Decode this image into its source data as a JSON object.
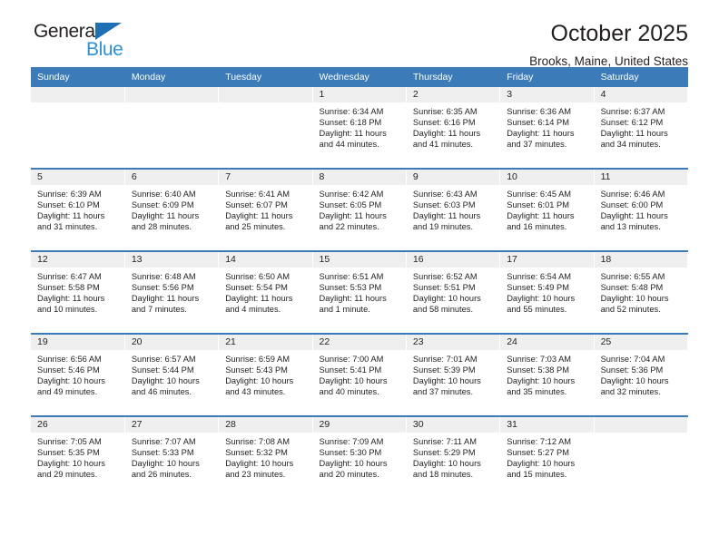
{
  "brand": {
    "name_top": "General",
    "name_bottom": "Blue",
    "triangle_color": "#1f6fb5",
    "blue_color": "#2f90d8",
    "dark_color": "#231f20"
  },
  "header": {
    "title": "October 2025",
    "subtitle": "Brooks, Maine, United States"
  },
  "theme": {
    "header_bg": "#3b7cb8",
    "header_text": "#ffffff",
    "daynum_bg": "#efefef",
    "cell_bg": "#ffffff",
    "text": "#231f20"
  },
  "weekday_headers": [
    "Sunday",
    "Monday",
    "Tuesday",
    "Wednesday",
    "Thursday",
    "Friday",
    "Saturday"
  ],
  "labels": {
    "sunrise": "Sunrise:",
    "sunset": "Sunset:",
    "daylight": "Daylight:"
  },
  "weeks": [
    [
      {
        "day": "",
        "empty": true,
        "line1": "",
        "line2": "",
        "line3": "",
        "line4": ""
      },
      {
        "day": "",
        "empty": true,
        "line1": "",
        "line2": "",
        "line3": "",
        "line4": ""
      },
      {
        "day": "",
        "empty": true,
        "line1": "",
        "line2": "",
        "line3": "",
        "line4": ""
      },
      {
        "day": "1",
        "empty": false,
        "line1": "Sunrise: 6:34 AM",
        "line2": "Sunset: 6:18 PM",
        "line3": "Daylight: 11 hours",
        "line4": "and 44 minutes."
      },
      {
        "day": "2",
        "empty": false,
        "line1": "Sunrise: 6:35 AM",
        "line2": "Sunset: 6:16 PM",
        "line3": "Daylight: 11 hours",
        "line4": "and 41 minutes."
      },
      {
        "day": "3",
        "empty": false,
        "line1": "Sunrise: 6:36 AM",
        "line2": "Sunset: 6:14 PM",
        "line3": "Daylight: 11 hours",
        "line4": "and 37 minutes."
      },
      {
        "day": "4",
        "empty": false,
        "line1": "Sunrise: 6:37 AM",
        "line2": "Sunset: 6:12 PM",
        "line3": "Daylight: 11 hours",
        "line4": "and 34 minutes."
      }
    ],
    [
      {
        "day": "5",
        "empty": false,
        "line1": "Sunrise: 6:39 AM",
        "line2": "Sunset: 6:10 PM",
        "line3": "Daylight: 11 hours",
        "line4": "and 31 minutes."
      },
      {
        "day": "6",
        "empty": false,
        "line1": "Sunrise: 6:40 AM",
        "line2": "Sunset: 6:09 PM",
        "line3": "Daylight: 11 hours",
        "line4": "and 28 minutes."
      },
      {
        "day": "7",
        "empty": false,
        "line1": "Sunrise: 6:41 AM",
        "line2": "Sunset: 6:07 PM",
        "line3": "Daylight: 11 hours",
        "line4": "and 25 minutes."
      },
      {
        "day": "8",
        "empty": false,
        "line1": "Sunrise: 6:42 AM",
        "line2": "Sunset: 6:05 PM",
        "line3": "Daylight: 11 hours",
        "line4": "and 22 minutes."
      },
      {
        "day": "9",
        "empty": false,
        "line1": "Sunrise: 6:43 AM",
        "line2": "Sunset: 6:03 PM",
        "line3": "Daylight: 11 hours",
        "line4": "and 19 minutes."
      },
      {
        "day": "10",
        "empty": false,
        "line1": "Sunrise: 6:45 AM",
        "line2": "Sunset: 6:01 PM",
        "line3": "Daylight: 11 hours",
        "line4": "and 16 minutes."
      },
      {
        "day": "11",
        "empty": false,
        "line1": "Sunrise: 6:46 AM",
        "line2": "Sunset: 6:00 PM",
        "line3": "Daylight: 11 hours",
        "line4": "and 13 minutes."
      }
    ],
    [
      {
        "day": "12",
        "empty": false,
        "line1": "Sunrise: 6:47 AM",
        "line2": "Sunset: 5:58 PM",
        "line3": "Daylight: 11 hours",
        "line4": "and 10 minutes."
      },
      {
        "day": "13",
        "empty": false,
        "line1": "Sunrise: 6:48 AM",
        "line2": "Sunset: 5:56 PM",
        "line3": "Daylight: 11 hours",
        "line4": "and 7 minutes."
      },
      {
        "day": "14",
        "empty": false,
        "line1": "Sunrise: 6:50 AM",
        "line2": "Sunset: 5:54 PM",
        "line3": "Daylight: 11 hours",
        "line4": "and 4 minutes."
      },
      {
        "day": "15",
        "empty": false,
        "line1": "Sunrise: 6:51 AM",
        "line2": "Sunset: 5:53 PM",
        "line3": "Daylight: 11 hours",
        "line4": "and 1 minute."
      },
      {
        "day": "16",
        "empty": false,
        "line1": "Sunrise: 6:52 AM",
        "line2": "Sunset: 5:51 PM",
        "line3": "Daylight: 10 hours",
        "line4": "and 58 minutes."
      },
      {
        "day": "17",
        "empty": false,
        "line1": "Sunrise: 6:54 AM",
        "line2": "Sunset: 5:49 PM",
        "line3": "Daylight: 10 hours",
        "line4": "and 55 minutes."
      },
      {
        "day": "18",
        "empty": false,
        "line1": "Sunrise: 6:55 AM",
        "line2": "Sunset: 5:48 PM",
        "line3": "Daylight: 10 hours",
        "line4": "and 52 minutes."
      }
    ],
    [
      {
        "day": "19",
        "empty": false,
        "line1": "Sunrise: 6:56 AM",
        "line2": "Sunset: 5:46 PM",
        "line3": "Daylight: 10 hours",
        "line4": "and 49 minutes."
      },
      {
        "day": "20",
        "empty": false,
        "line1": "Sunrise: 6:57 AM",
        "line2": "Sunset: 5:44 PM",
        "line3": "Daylight: 10 hours",
        "line4": "and 46 minutes."
      },
      {
        "day": "21",
        "empty": false,
        "line1": "Sunrise: 6:59 AM",
        "line2": "Sunset: 5:43 PM",
        "line3": "Daylight: 10 hours",
        "line4": "and 43 minutes."
      },
      {
        "day": "22",
        "empty": false,
        "line1": "Sunrise: 7:00 AM",
        "line2": "Sunset: 5:41 PM",
        "line3": "Daylight: 10 hours",
        "line4": "and 40 minutes."
      },
      {
        "day": "23",
        "empty": false,
        "line1": "Sunrise: 7:01 AM",
        "line2": "Sunset: 5:39 PM",
        "line3": "Daylight: 10 hours",
        "line4": "and 37 minutes."
      },
      {
        "day": "24",
        "empty": false,
        "line1": "Sunrise: 7:03 AM",
        "line2": "Sunset: 5:38 PM",
        "line3": "Daylight: 10 hours",
        "line4": "and 35 minutes."
      },
      {
        "day": "25",
        "empty": false,
        "line1": "Sunrise: 7:04 AM",
        "line2": "Sunset: 5:36 PM",
        "line3": "Daylight: 10 hours",
        "line4": "and 32 minutes."
      }
    ],
    [
      {
        "day": "26",
        "empty": false,
        "line1": "Sunrise: 7:05 AM",
        "line2": "Sunset: 5:35 PM",
        "line3": "Daylight: 10 hours",
        "line4": "and 29 minutes."
      },
      {
        "day": "27",
        "empty": false,
        "line1": "Sunrise: 7:07 AM",
        "line2": "Sunset: 5:33 PM",
        "line3": "Daylight: 10 hours",
        "line4": "and 26 minutes."
      },
      {
        "day": "28",
        "empty": false,
        "line1": "Sunrise: 7:08 AM",
        "line2": "Sunset: 5:32 PM",
        "line3": "Daylight: 10 hours",
        "line4": "and 23 minutes."
      },
      {
        "day": "29",
        "empty": false,
        "line1": "Sunrise: 7:09 AM",
        "line2": "Sunset: 5:30 PM",
        "line3": "Daylight: 10 hours",
        "line4": "and 20 minutes."
      },
      {
        "day": "30",
        "empty": false,
        "line1": "Sunrise: 7:11 AM",
        "line2": "Sunset: 5:29 PM",
        "line3": "Daylight: 10 hours",
        "line4": "and 18 minutes."
      },
      {
        "day": "31",
        "empty": false,
        "line1": "Sunrise: 7:12 AM",
        "line2": "Sunset: 5:27 PM",
        "line3": "Daylight: 10 hours",
        "line4": "and 15 minutes."
      },
      {
        "day": "",
        "empty": true,
        "line1": "",
        "line2": "",
        "line3": "",
        "line4": ""
      }
    ]
  ]
}
